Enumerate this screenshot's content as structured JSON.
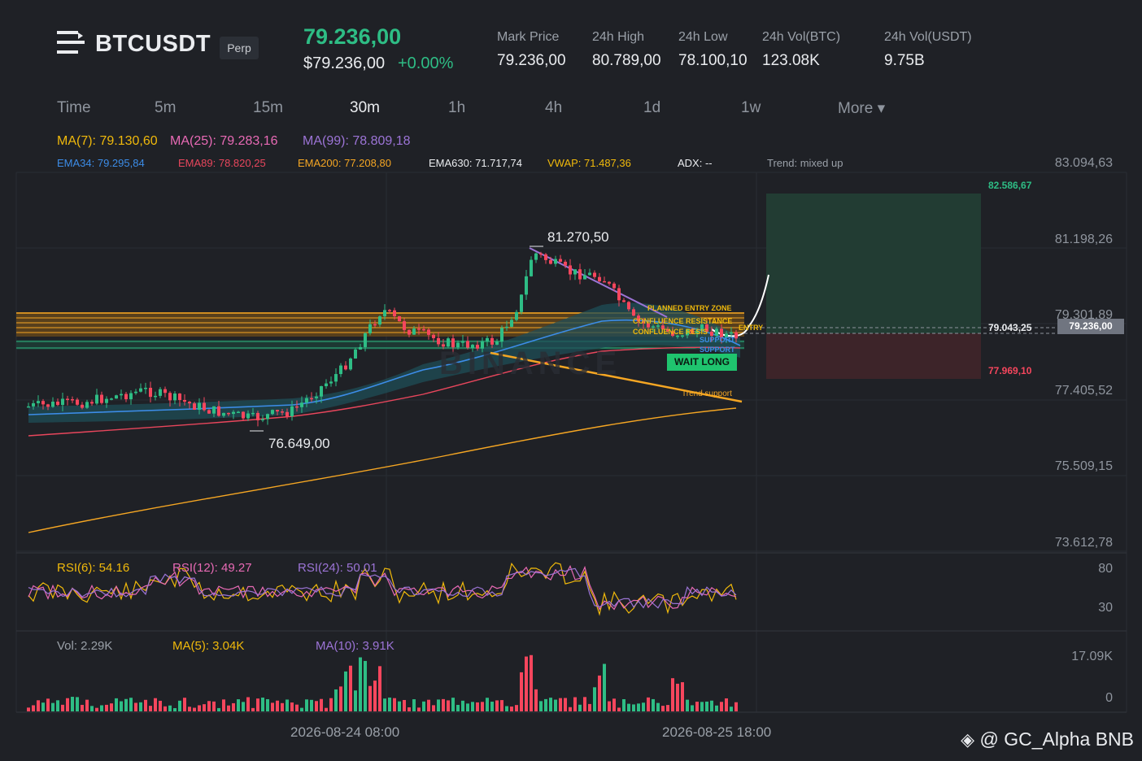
{
  "header": {
    "symbol": "BTCUSDT",
    "contract_type": "Perp",
    "last_price": "79.236,00",
    "last_price_usd": "$79.236,00",
    "change_pct": "+0.00%",
    "stats": [
      {
        "label": "Mark Price",
        "value": "79.236,00"
      },
      {
        "label": "24h High",
        "value": "80.789,00"
      },
      {
        "label": "24h Low",
        "value": "78.100,10"
      },
      {
        "label": "24h Vol(BTC)",
        "value": "123.08K"
      },
      {
        "label": "24h Vol(USDT)",
        "value": "9.75B"
      }
    ]
  },
  "timeframes": {
    "items": [
      "Time",
      "5m",
      "15m",
      "30m",
      "1h",
      "4h",
      "1d",
      "1w",
      "More ▾"
    ],
    "active": "30m"
  },
  "indicators": {
    "ma7": "MA(7): 79.130,60",
    "ma25": "MA(25): 79.283,16",
    "ma99": "MA(99): 78.809,18",
    "ema34": "EMA34: 79.295,84",
    "ema89": "EMA89: 78.820,25",
    "ema200": "EMA200: 77.208,80",
    "ema630": "EMA630: 71.717,74",
    "vwap": "VWAP: 71.487,36",
    "adx": "ADX: --",
    "trend": "Trend: mixed up"
  },
  "colors": {
    "up": "#2ebd85",
    "down": "#f6465d",
    "ma7": "#f0b90b",
    "ma25": "#e86ab5",
    "ma99": "#9c74d6",
    "ema34": "#3c8ce7",
    "ema89": "#e8465c",
    "ema200": "#f5a623",
    "target_zone": "#2a5144",
    "stop_zone": "#4a2a30"
  },
  "price_axis": [
    "83.094,63",
    "81.198,26",
    "79.301,89",
    "77.405,52",
    "75.509,15",
    "73.612,78"
  ],
  "annotations": {
    "high_marker": "81.270,50",
    "low_marker": "76.649,00",
    "planned_entry_zone": "PLANNED ENTRY ZONE",
    "confluence_resistance": "CONFLUENCE RESISTANCE",
    "confluence_resis2": "CONFLUENCE RESIS",
    "entry": "ENTRY",
    "support1": "SUPPORT",
    "support2": "SUPPORT",
    "wait_long": "WAIT LONG",
    "trend_support": "Trend support",
    "target_price": "82.586,67",
    "entry_price": "79.043,25",
    "stop_price": "77.969,10",
    "current_price_tag": "79.236,00",
    "watermark_center": "BINANCE"
  },
  "rsi": {
    "rsi6": "RSI(6): 54.16",
    "rsi12": "RSI(12): 49.27",
    "rsi24": "RSI(24): 50.01",
    "axis": [
      "80",
      "30"
    ]
  },
  "volume": {
    "vol": "Vol: 2.29K",
    "ma5": "MA(5): 3.04K",
    "ma10": "MA(10): 3.91K",
    "axis": [
      "17.09K",
      "0"
    ]
  },
  "time_axis": [
    "2026-08-24 08:00",
    "2026-08-25 18:00"
  ],
  "footer": {
    "watermark": "@ GC_Alpha BNB"
  }
}
